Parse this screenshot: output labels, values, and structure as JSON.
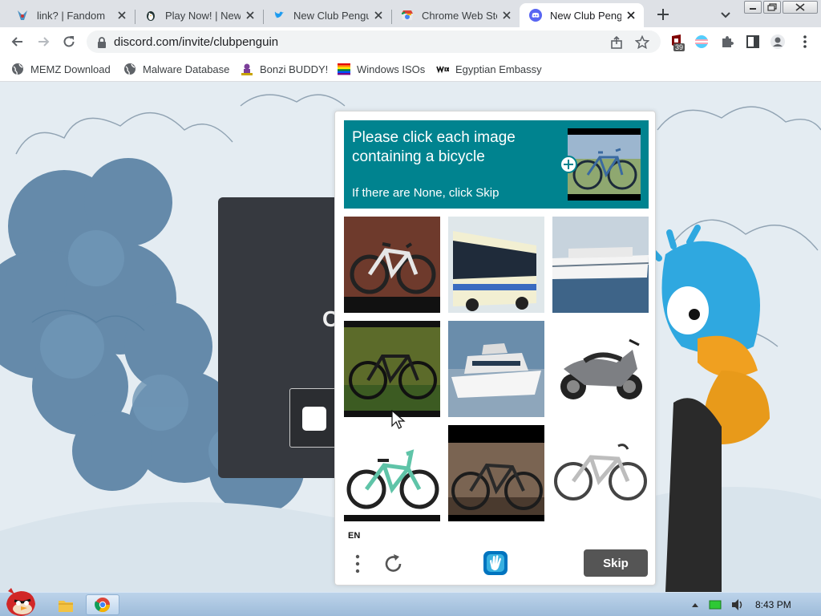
{
  "browser": {
    "tabs": [
      {
        "title": "link? | Fandom",
        "icon": "fandom-favicon",
        "active": false
      },
      {
        "title": "Play Now! | New",
        "icon": "penguin-favicon",
        "active": false
      },
      {
        "title": "New Club Pengu",
        "icon": "twitter-bird-favicon",
        "active": false
      },
      {
        "title": "Chrome Web Sto",
        "icon": "chrome-web-store-favicon",
        "active": false
      },
      {
        "title": "New Club Pengu",
        "icon": "discord-favicon",
        "active": true
      }
    ],
    "address": {
      "url": "discord.com/invite/clubpenguin"
    },
    "extensions": {
      "badge": "39"
    },
    "bookmarks": [
      {
        "label": "MEMZ Download",
        "icon": "globe-icon"
      },
      {
        "label": "Malware Database",
        "icon": "globe-icon"
      },
      {
        "label": "Bonzi BUDDY!",
        "icon": "bonzi-icon"
      },
      {
        "label": "Windows ISOs",
        "icon": "windows-flag-icon"
      },
      {
        "label": "Egyptian Embassy",
        "icon": "wix-icon"
      }
    ]
  },
  "captcha": {
    "prompt": "Please click each image containing a bicycle",
    "subtext": "If there are None, click Skip",
    "images": [
      {
        "subject": "mountain bicycle"
      },
      {
        "subject": "city bus"
      },
      {
        "subject": "cruise ship"
      },
      {
        "subject": "bicycle in grass"
      },
      {
        "subject": "motor yacht"
      },
      {
        "subject": "motor scooter"
      },
      {
        "subject": "bmx bicycle"
      },
      {
        "subject": "road bicycle indoors"
      },
      {
        "subject": "white road bicycle"
      }
    ],
    "language": "EN",
    "skip_label": "Skip"
  },
  "colors": {
    "accent": "#00838f",
    "skip": "#555555",
    "discord": "#5865f2"
  },
  "taskbar": {
    "time": "8:43 PM"
  }
}
